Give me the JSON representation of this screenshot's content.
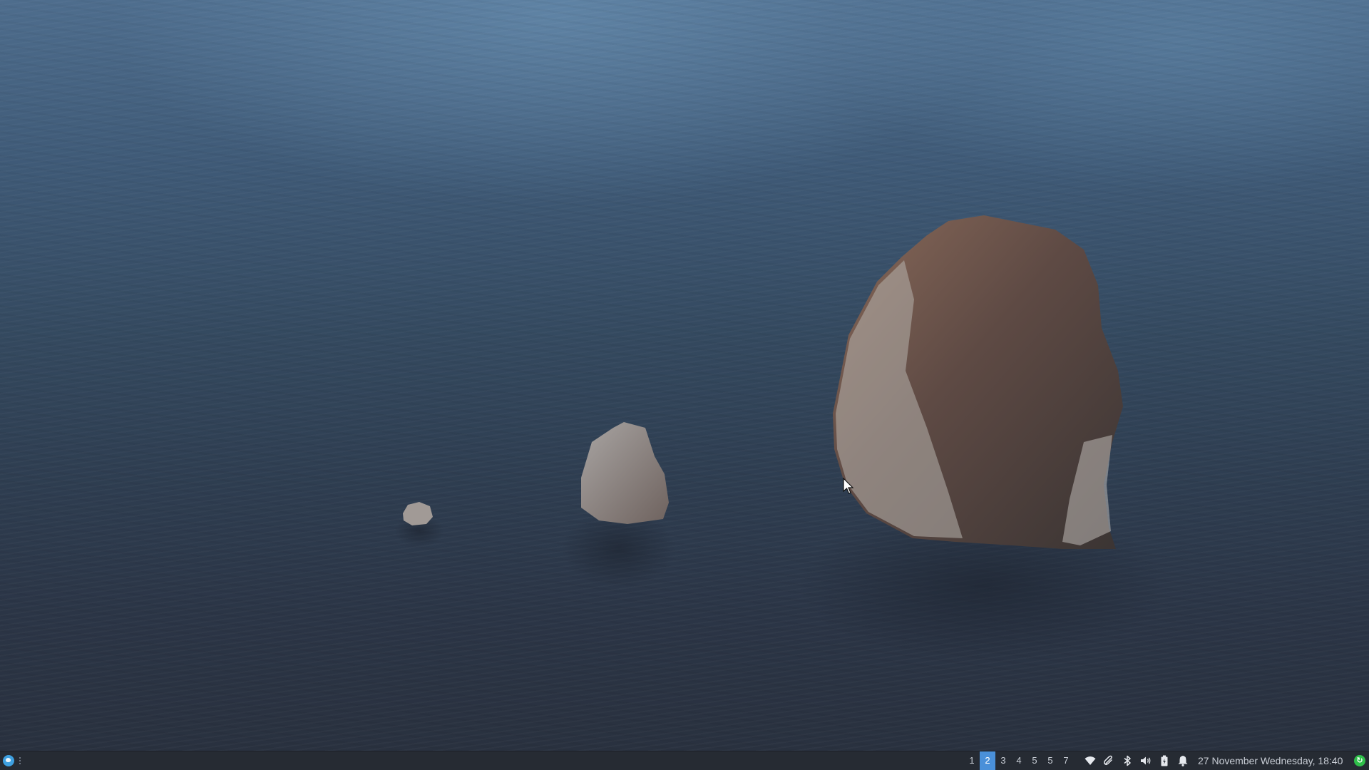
{
  "desktop": {
    "wallpaper": "sea-rocks"
  },
  "taskbar": {
    "launcher_icon": "app-launcher-icon",
    "workspaces": [
      {
        "label": "1",
        "active": false
      },
      {
        "label": "2",
        "active": true
      },
      {
        "label": "3",
        "active": false
      },
      {
        "label": "4",
        "active": false
      },
      {
        "label": "5",
        "active": false
      },
      {
        "label": "5",
        "active": false
      },
      {
        "label": "7",
        "active": false
      }
    ],
    "tray_icons": [
      "wifi-icon",
      "attachment-icon",
      "bluetooth-icon",
      "volume-icon",
      "battery-icon",
      "notification-bell-icon"
    ],
    "clock": "27 November Wednesday, 18:40",
    "update_icon": "update-icon"
  },
  "colors": {
    "taskbar_bg": "#262b33",
    "active_workspace": "#4a90d9",
    "update_green": "#2fbf4a"
  }
}
